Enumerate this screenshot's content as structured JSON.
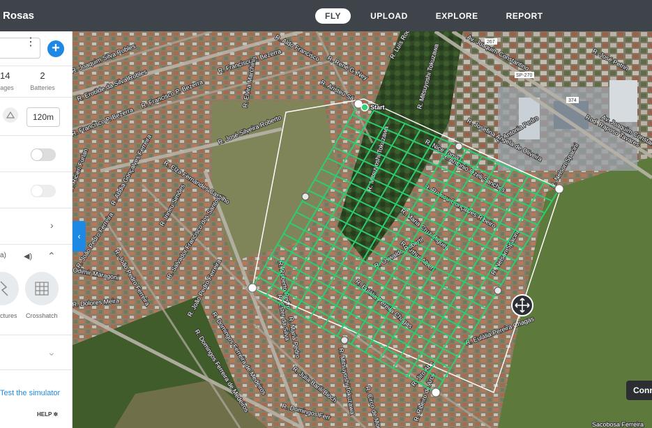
{
  "header": {
    "project_title": "Rosas",
    "tabs": [
      {
        "label": "FLY",
        "active": true
      },
      {
        "label": "UPLOAD",
        "active": false
      },
      {
        "label": "EXPLORE",
        "active": false
      },
      {
        "label": "REPORT",
        "active": false
      }
    ]
  },
  "panel": {
    "stats": [
      {
        "value": "14",
        "label": "ages"
      },
      {
        "value": "2",
        "label": "Batteries"
      }
    ],
    "altitude": "120m",
    "voice_label": "a)",
    "patterns": [
      {
        "label": "ctures",
        "icon": "polygon-path-icon"
      },
      {
        "label": "Crosshatch",
        "icon": "crosshatch-icon"
      }
    ],
    "simulator_link": "Test the simulator",
    "help_label": "HELP"
  },
  "map": {
    "start_label": "Start",
    "grid_color": "#2ecc71",
    "connect_label": "Conn",
    "streets": [
      "R. Joaquim Silva Robles",
      "R. Erotilde da Silva Robles",
      "R. Francisco P. Bezerra",
      "R. Francisco P. Bezerra",
      "R. Francisco P. Bezerra",
      "R. Elvira Marchini",
      "R. José Silveira Roberto",
      "R. Ricieri Furlan",
      "R. Elza Fernandes Castilho",
      "R. Abdia Gonçalves Ferreira",
      "R. Irineu Simões",
      "R. Salvador Francisco dos Santos",
      "R. João Pedro Ferreira",
      "R. João Pedro Ferreira",
      "R. João Pedro Ferreira",
      "Odimir Maragoni",
      "R. Dolores Meira",
      "R. Domingos Ferreira de Medeiros",
      "R. Domingos Ferreira de Medeiros",
      "R. Julia Barili Bioch",
      "R. Domingos Ferr",
      "R. Roberto Pedro",
      "R. Maria Pedro",
      "R. Ester da Silva",
      "R. Mitsuyoshi Tokuzawa",
      "R. Mitsuyoshi Tokuzawa",
      "R. Mitsuyoshi Tokuzawa",
      "R. Romeu Gonçalves Ribeiro",
      "R. Maria Cruz Miguel",
      "R. Arthur Albert",
      "R. Oswaldo Roberti",
      "R. Eulália Pereira Chagas",
      "R. Eulália Pereira Chagas",
      "R. Antonia Pedro",
      "R. Jiro Abe",
      "R. Nelson Spacini",
      "R. Nelson Spacini",
      "R. Antonio Ozeli Sanches",
      "R. Josefina Angela de Oliveira",
      "R. Nice Tomaz",
      "Av. Joaquim Constantino",
      "Av. Joaquim Constantino",
      "Rod. Raposo Tavares",
      "R. José Petrin",
      "R. René G. Ney",
      "R. Aristeu Sá",
      "R. Luís Rodrigues",
      "R. Aldo Francisco",
      "R. Ribeiro de Arco",
      "R. Circo de Moreira",
      "Sacobosa Ferreira"
    ],
    "road_signs": [
      "267",
      "SP-270",
      "374"
    ]
  }
}
